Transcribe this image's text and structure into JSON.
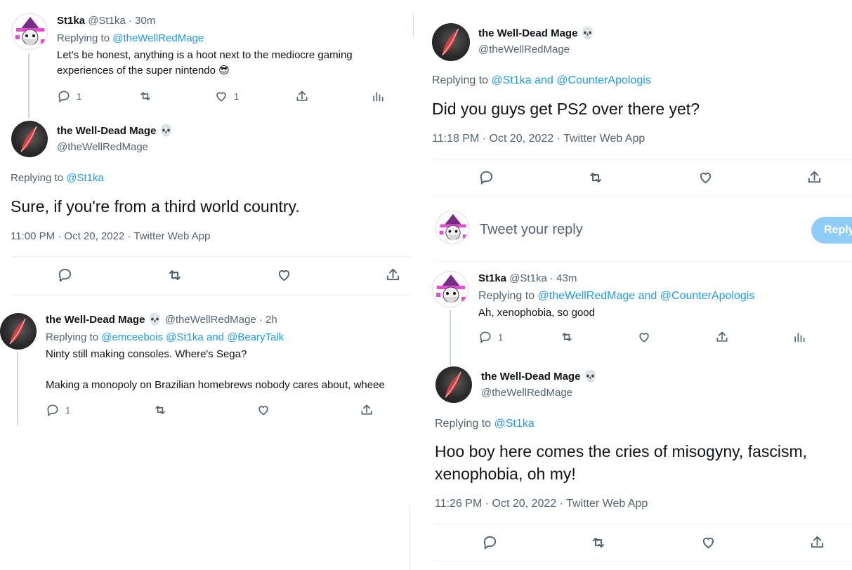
{
  "colors": {
    "accent": "#1d9bf0",
    "text": "#0f1419",
    "muted": "#536471",
    "divider": "#eff3f4"
  },
  "left": {
    "tweet1": {
      "name": "St1ka",
      "handle": "@St1ka",
      "time": "· 30m",
      "replying_prefix": "Replying to",
      "replying_to": "@theWellRedMage",
      "text": "Let's be honest, anything is a hoot next to the mediocre gaming experiences of the super nintendo",
      "emoji": "😎",
      "reply_count": "1",
      "like_count": "1"
    },
    "main": {
      "name": "the Well-Dead Mage",
      "skull": "💀",
      "handle": "@theWellRedMage",
      "replying_prefix": "Replying to",
      "replying_to": "@St1ka",
      "text": "Sure, if you're from a third world country.",
      "meta": "11:00 PM · Oct 20, 2022 · Twitter Web App"
    },
    "tweet3": {
      "name": "the Well-Dead Mage",
      "skull": "💀",
      "handle": "@theWellRedMage",
      "time": "· 2h",
      "replying_prefix": "Replying to",
      "replying_to": "@emceebois @St1ka and @BearyTalk",
      "line1": "Ninty still making consoles. Where's Sega?",
      "line2": "Making a monopoly on Brazilian homebrews nobody cares about, wheee",
      "reply_count": "1"
    }
  },
  "right": {
    "main1": {
      "name": "the Well-Dead Mage",
      "skull": "💀",
      "handle": "@theWellRedMage",
      "replying_prefix": "Replying to",
      "replying_to": "@St1ka and @CounterApologis",
      "text": "Did you guys get PS2 over there yet?",
      "meta": "11:18 PM · Oct 20, 2022 · Twitter Web App"
    },
    "compose": {
      "placeholder": "Tweet your reply",
      "button": "Reply"
    },
    "tweet2": {
      "name": "St1ka",
      "handle": "@St1ka",
      "time": "· 43m",
      "replying_prefix": "Replying to",
      "replying_to": "@theWellRedMage and @CounterApologis",
      "text": "Ah, xenophobia, so good",
      "reply_count": "1"
    },
    "main2": {
      "name": "the Well-Dead Mage",
      "skull": "💀",
      "handle": "@theWellRedMage",
      "replying_prefix": "Replying to",
      "replying_to": "@St1ka",
      "text": "Hoo boy here comes the cries of misogyny, fascism, xenophobia, oh my!",
      "meta": "11:26 PM · Oct 20, 2022 · Twitter Web App"
    }
  }
}
